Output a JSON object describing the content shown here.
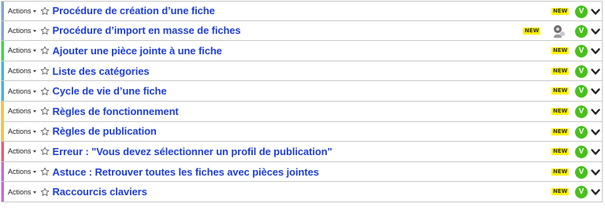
{
  "actions_label": "Actions",
  "badge_label": "NEW",
  "validate_label": "V",
  "rows": [
    {
      "title": "Procédure de création d’une fiche",
      "stripe": "#7fa7d9",
      "badge_pos": "right",
      "has_ghost": false
    },
    {
      "title": "Procédure d’import en masse de fiches",
      "stripe": "#7fa7d9",
      "badge_pos": "left",
      "has_ghost": true
    },
    {
      "title": "Ajouter une pièce jointe à une fiche",
      "stripe": "#42d44b",
      "badge_pos": "right",
      "has_ghost": false
    },
    {
      "title": "Liste des catégories",
      "stripe": "#3fb9d6",
      "badge_pos": "right",
      "has_ghost": false
    },
    {
      "title": "Cycle de vie d’une fiche",
      "stripe": "#3fb9d6",
      "badge_pos": "right",
      "has_ghost": false
    },
    {
      "title": "Règles de fonctionnement",
      "stripe": "#f5c542",
      "badge_pos": "right",
      "has_ghost": false
    },
    {
      "title": "Règles de publication",
      "stripe": "#f5c542",
      "badge_pos": "right",
      "has_ghost": false
    },
    {
      "title": "Erreur : \"Vous devez sélectionner un profil de publication\"",
      "stripe": "#e85a7a",
      "badge_pos": "right",
      "has_ghost": false
    },
    {
      "title": "Astuce : Retrouver toutes les fiches avec pièces jointes",
      "stripe": "#c46bd6",
      "badge_pos": "right",
      "has_ghost": false
    },
    {
      "title": "Raccourcis claviers",
      "stripe": "#c46bd6",
      "badge_pos": "right",
      "has_ghost": false
    }
  ],
  "icons": {
    "star": "star-outline-icon",
    "caret": "caret-down-icon",
    "validate": "check-v-circle-icon",
    "chevron": "chevron-down-icon",
    "ghost": "user-ghost-icon"
  },
  "colors": {
    "title": "#1e3fd9",
    "badge_bg": "#fff200",
    "validate_bg": "#49c01e",
    "border": "#c9c9c9"
  }
}
